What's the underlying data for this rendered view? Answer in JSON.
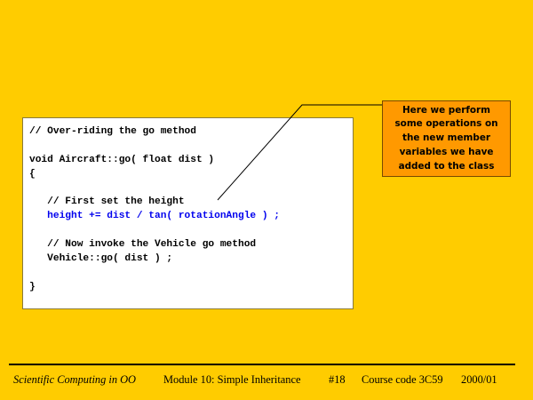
{
  "code": {
    "lines": [
      {
        "text": "// Over-riding the go method",
        "highlight": false
      },
      {
        "text": "",
        "highlight": false
      },
      {
        "text": "void Aircraft::go( float dist )",
        "highlight": false
      },
      {
        "text": "{",
        "highlight": false
      },
      {
        "text": "",
        "highlight": false
      },
      {
        "text": "   // First set the height",
        "highlight": false
      },
      {
        "text": "   height += dist / tan( rotationAngle ) ;",
        "highlight": true
      },
      {
        "text": "",
        "highlight": false
      },
      {
        "text": "   // Now invoke the Vehicle go method",
        "highlight": false
      },
      {
        "text": "   Vehicle::go( dist ) ;",
        "highlight": false
      },
      {
        "text": "",
        "highlight": false
      },
      {
        "text": "}",
        "highlight": false
      }
    ],
    "highlight_color": "#0000ee"
  },
  "callout": {
    "lines": [
      "Here we perform",
      "some operations on",
      "the new member",
      "variables we have",
      "added to the class"
    ],
    "background": "#ff9900"
  },
  "footer": {
    "course_title": "Scientific Computing in OO",
    "module": "Module 10: Simple  Inheritance",
    "slide_number": "#18",
    "course_code": "Course code 3C59",
    "year": "2000/01"
  },
  "colors": {
    "background": "#ffcc00",
    "code_background": "#ffffff"
  }
}
